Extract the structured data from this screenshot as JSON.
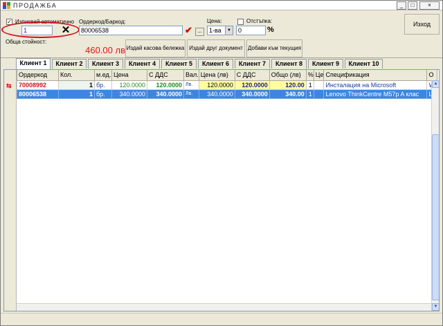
{
  "window": {
    "title": "ПРОДАЖБА",
    "controls": {
      "minimize": "_",
      "maximize": "□",
      "close": "×"
    }
  },
  "top": {
    "auto_write_label": "Изписвай автоматично",
    "auto_write_checked": "✓",
    "quantity_value": "1",
    "barcode_label": "Ордеркод/Баркод:",
    "barcode_value": "80006538",
    "browse_label": "...",
    "price_label": "Цена:",
    "price_select_value": "1-ва",
    "discount_label": "Отстъпка:",
    "discount_checked": "",
    "discount_value": "0",
    "discount_unit": "%",
    "exit_label": "Изход",
    "total_label": "Обща стойност:",
    "total_value": "460.00 лв",
    "buttons": {
      "receipt": "Издай касова бележка",
      "other_doc": "Издай друг документ",
      "add_current": "Добави към текущия"
    }
  },
  "tabs": [
    "Клиент 1",
    "Клиент 2",
    "Клиент 3",
    "Клиент 4",
    "Клиент 5",
    "Клиент 6",
    "Клиент 7",
    "Клиент 8",
    "Клиент 9",
    "Клиент 10"
  ],
  "grid": {
    "columns": [
      "Ордеркод",
      "Кол.",
      "м.ед.",
      "Цена",
      "С ДДС",
      "Вал.",
      "Цена (лв)",
      "С ДДС",
      "Общо (лв)",
      "%",
      "Це",
      "Спецификация",
      "О"
    ],
    "rows": [
      [
        "70008992",
        "1",
        "бр.",
        "120.0000",
        "120.0000",
        "Лв.",
        "120.0000",
        "120.0000",
        "120.00",
        "1",
        "Инсталация на Microsoft",
        "W"
      ],
      [
        "80006538",
        "1",
        "бр.",
        "340.0000",
        "340.0000",
        "Лв.",
        "340.0000",
        "340.0000",
        "340.00",
        "1",
        "Lenovo ThinkCentre M57p A клас",
        "Le"
      ]
    ],
    "row_marker": "≡"
  },
  "colors": {
    "accent_red": "#d0111b",
    "selected_row": "#3b86e0",
    "highlight_yellow": "#fffda0"
  }
}
